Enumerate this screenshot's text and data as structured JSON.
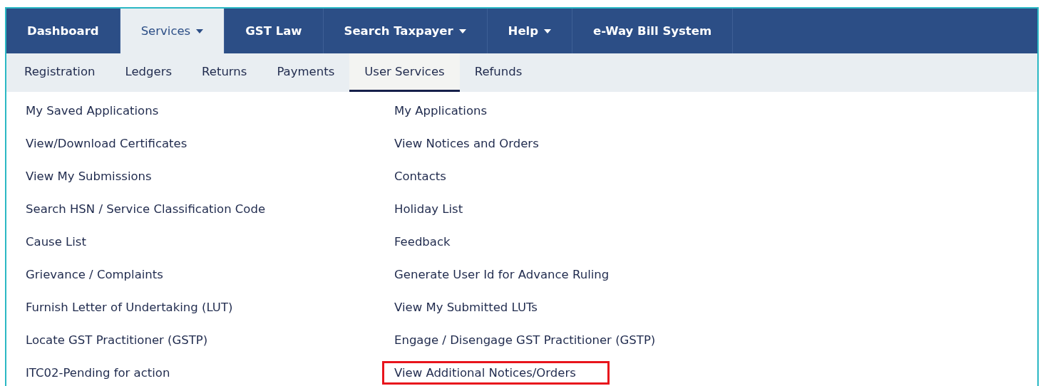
{
  "top_nav": [
    {
      "label": "Dashboard",
      "selected": false,
      "dropdown": false
    },
    {
      "label": "Services",
      "selected": true,
      "dropdown": true
    },
    {
      "label": "GST Law",
      "selected": false,
      "dropdown": false
    },
    {
      "label": "Search Taxpayer",
      "selected": false,
      "dropdown": true
    },
    {
      "label": "Help",
      "selected": false,
      "dropdown": true
    },
    {
      "label": "e-Way Bill System",
      "selected": false,
      "dropdown": false
    }
  ],
  "sub_nav": [
    {
      "label": "Registration",
      "selected": false
    },
    {
      "label": "Ledgers",
      "selected": false
    },
    {
      "label": "Returns",
      "selected": false
    },
    {
      "label": "Payments",
      "selected": false
    },
    {
      "label": "User Services",
      "selected": true
    },
    {
      "label": "Refunds",
      "selected": false
    }
  ],
  "menu_columns": [
    {
      "items": [
        {
          "label": "My Saved Applications",
          "highlighted": false
        },
        {
          "label": "View/Download Certificates",
          "highlighted": false
        },
        {
          "label": "View My Submissions",
          "highlighted": false
        },
        {
          "label": "Search HSN / Service Classification Code",
          "highlighted": false
        },
        {
          "label": "Cause List",
          "highlighted": false
        },
        {
          "label": "Grievance / Complaints",
          "highlighted": false
        },
        {
          "label": "Furnish Letter of Undertaking (LUT)",
          "highlighted": false
        },
        {
          "label": "Locate GST Practitioner (GSTP)",
          "highlighted": false
        },
        {
          "label": "ITC02-Pending for action",
          "highlighted": false
        }
      ]
    },
    {
      "items": [
        {
          "label": "My Applications",
          "highlighted": false
        },
        {
          "label": "View Notices and Orders",
          "highlighted": false
        },
        {
          "label": "Contacts",
          "highlighted": false
        },
        {
          "label": "Holiday List",
          "highlighted": false
        },
        {
          "label": "Feedback",
          "highlighted": false
        },
        {
          "label": "Generate User Id for Advance Ruling",
          "highlighted": false
        },
        {
          "label": "View My Submitted LUTs",
          "highlighted": false
        },
        {
          "label": "Engage / Disengage GST Practitioner (GSTP)",
          "highlighted": false
        },
        {
          "label": "View Additional Notices/Orders",
          "highlighted": true
        }
      ]
    }
  ]
}
